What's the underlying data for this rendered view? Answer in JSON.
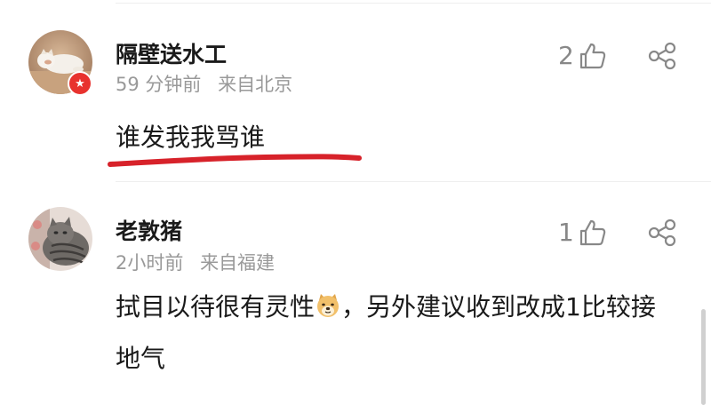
{
  "comments": [
    {
      "username": "隔壁送水工",
      "time": "59 分钟前",
      "location": "来自北京",
      "text": "谁发我我骂谁",
      "likes": "2",
      "avatar_icon": "cat-lying-avatar",
      "badge_icon": "vip-star-badge"
    },
    {
      "username": "老敦猪",
      "time": "2小时前",
      "location": "来自福建",
      "text_before_emoji": "拭目以待很有灵性",
      "emoji_icon": "doge-emoji",
      "text_after_emoji": "，另外建议收到改成1比较接地气",
      "likes": "1",
      "avatar_icon": "tabby-cat-avatar"
    }
  ],
  "colors": {
    "username": "#1a1a1a",
    "meta": "#999999",
    "icon": "#888888",
    "underline_mark": "#d7222a",
    "badge": "#e8322e"
  }
}
